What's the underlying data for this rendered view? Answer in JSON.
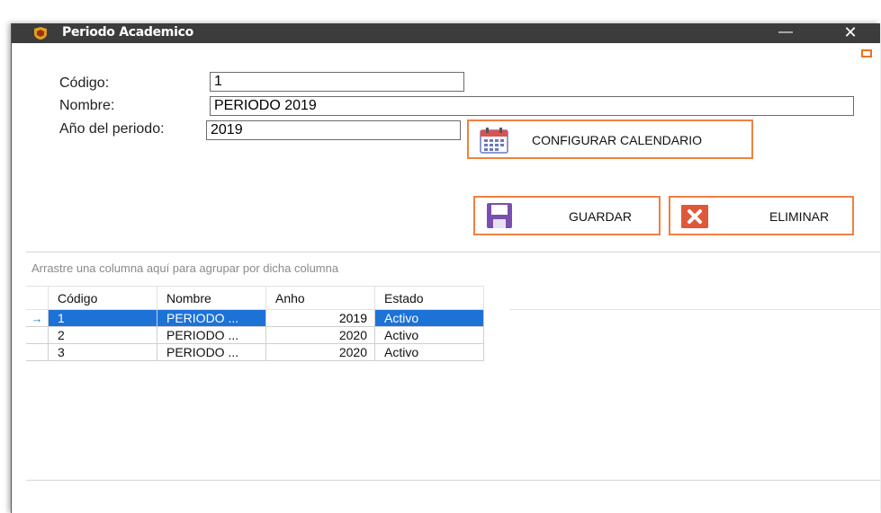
{
  "window": {
    "title": "Periodo Academico",
    "minimize_glyph": "—",
    "close_glyph": "✕"
  },
  "form": {
    "codigo_label": "Código:",
    "codigo_value": "1",
    "nombre_label": "Nombre:",
    "nombre_value": "PERIODO 2019",
    "anio_label": "Año del periodo:",
    "anio_value": "2019"
  },
  "buttons": {
    "configurar_label": "CONFIGURAR CALENDARIO",
    "guardar_label": "GUARDAR",
    "eliminar_label": "ELIMINAR"
  },
  "grid": {
    "group_hint": "Arrastre una columna aquí para agrupar por dicha columna",
    "columns": [
      "Código",
      "Nombre",
      "Anho",
      "Estado"
    ],
    "rows": [
      {
        "codigo": "1",
        "nombre": "PERIODO ...",
        "anho": "2019",
        "estado": "Activo"
      },
      {
        "codigo": "2",
        "nombre": "PERIODO ...",
        "anho": "2020",
        "estado": "Activo"
      },
      {
        "codigo": "3",
        "nombre": "PERIODO ...",
        "anho": "2020",
        "estado": "Activo"
      }
    ],
    "current_row_glyph": "→"
  },
  "colors": {
    "accent_border": "#f08040",
    "selection": "#1d72d8",
    "titlebar": "#3c3c3c"
  }
}
